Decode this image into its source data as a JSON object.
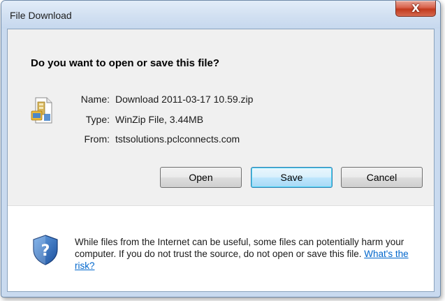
{
  "window": {
    "title": "File Download",
    "close_label": "X"
  },
  "dialog": {
    "question": "Do you want to open or save this file?",
    "file_icon": "winzip-file-icon",
    "details": [
      {
        "label": "Name:",
        "value": "Download 2011-03-17 10.59.zip"
      },
      {
        "label": "Type:",
        "value": "WinZip File, 3.44MB"
      },
      {
        "label": "From:",
        "value": "tstsolutions.pclconnects.com"
      }
    ],
    "buttons": {
      "open": "Open",
      "save": "Save",
      "cancel": "Cancel"
    },
    "warning_icon": "security-shield-icon",
    "warning_text": "While files from the Internet can be useful, some files can potentially harm your computer. If you do not trust the source, do not open or save this file.",
    "risk_link": "What's the risk?"
  },
  "colors": {
    "title_bar": "#d3e1f2",
    "close_button": "#c23a1e",
    "link": "#0066cc",
    "default_button": "#bee6fd"
  }
}
